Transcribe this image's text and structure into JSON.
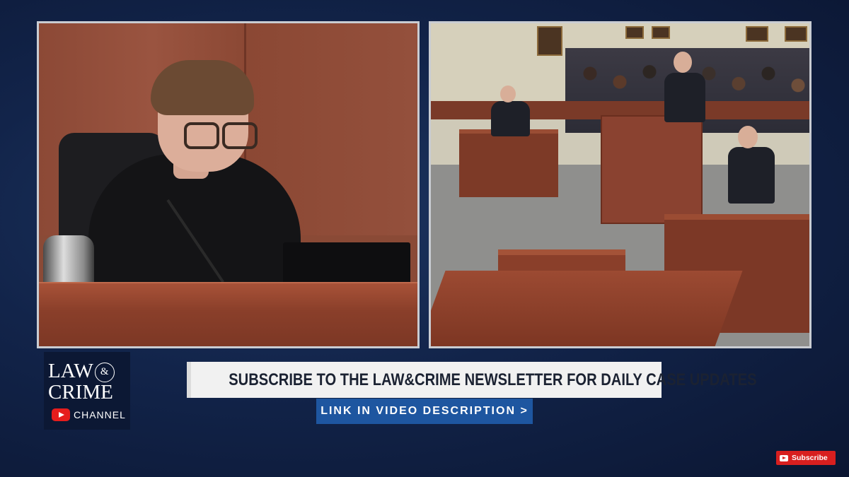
{
  "feeds": {
    "left": {
      "description_icon": "judge-camera-feed"
    },
    "right": {
      "description_icon": "courtroom-camera-feed"
    }
  },
  "logo": {
    "line1_word": "LAW",
    "amp": "&",
    "line2_word": "CRIME",
    "channel": "CHANNEL",
    "icon": "youtube-play-icon",
    "colors": {
      "youtube_red": "#e61d1d"
    }
  },
  "banner": {
    "newsletter": "SUBSCRIBE TO THE LAW&CRIME NEWSLETTER FOR DAILY CASE UPDATES",
    "link": "LINK IN VIDEO DESCRIPTION >"
  },
  "subscribe": {
    "label": "Subscribe",
    "icon": "youtube-play-icon",
    "color": "#d81f1f"
  },
  "colors": {
    "background": "#12244a",
    "link_banner": "#1e56a0",
    "newsletter_banner": "#f1f1f1"
  }
}
